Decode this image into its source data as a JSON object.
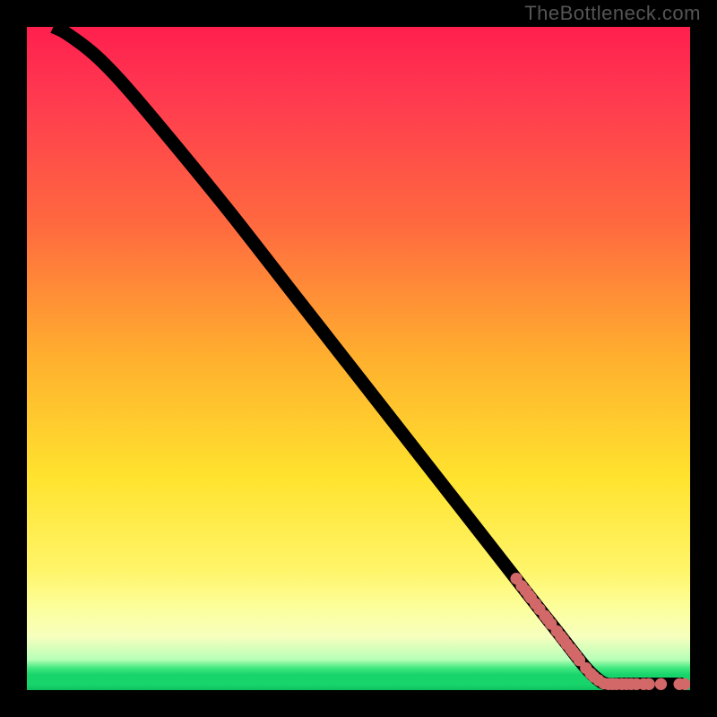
{
  "watermark": "TheBottleneck.com",
  "chart_data": {
    "type": "line",
    "title": "",
    "xlabel": "",
    "ylabel": "",
    "xlim": [
      0,
      100
    ],
    "ylim": [
      0,
      100
    ],
    "curve": [
      {
        "x": 4,
        "y": 100
      },
      {
        "x": 6,
        "y": 99
      },
      {
        "x": 10,
        "y": 96
      },
      {
        "x": 14,
        "y": 92
      },
      {
        "x": 20,
        "y": 85
      },
      {
        "x": 30,
        "y": 72.8
      },
      {
        "x": 40,
        "y": 60
      },
      {
        "x": 50,
        "y": 47.2
      },
      {
        "x": 60,
        "y": 34.4
      },
      {
        "x": 70,
        "y": 21.6
      },
      {
        "x": 77,
        "y": 12.6
      },
      {
        "x": 80,
        "y": 8.8
      },
      {
        "x": 84,
        "y": 3.7
      },
      {
        "x": 86,
        "y": 1.7
      },
      {
        "x": 87.5,
        "y": 0.9
      },
      {
        "x": 90,
        "y": 0.9
      },
      {
        "x": 95,
        "y": 0.9
      },
      {
        "x": 99,
        "y": 0.9
      }
    ],
    "points": [
      {
        "x": 73.8,
        "y": 16.8
      },
      {
        "x": 74.6,
        "y": 15.7
      },
      {
        "x": 75.2,
        "y": 15.0
      },
      {
        "x": 75.7,
        "y": 14.3
      },
      {
        "x": 76.0,
        "y": 13.9
      },
      {
        "x": 76.7,
        "y": 13.0
      },
      {
        "x": 77.3,
        "y": 12.2
      },
      {
        "x": 78.1,
        "y": 11.2
      },
      {
        "x": 78.5,
        "y": 10.7
      },
      {
        "x": 79.0,
        "y": 10.0
      },
      {
        "x": 79.9,
        "y": 8.9
      },
      {
        "x": 80.5,
        "y": 8.1
      },
      {
        "x": 80.9,
        "y": 7.6
      },
      {
        "x": 81.4,
        "y": 6.9
      },
      {
        "x": 82.0,
        "y": 6.2
      },
      {
        "x": 82.4,
        "y": 5.7
      },
      {
        "x": 82.8,
        "y": 5.2
      },
      {
        "x": 83.3,
        "y": 4.5
      },
      {
        "x": 84.3,
        "y": 3.3
      },
      {
        "x": 85.0,
        "y": 2.5
      },
      {
        "x": 85.5,
        "y": 2.0
      },
      {
        "x": 86.2,
        "y": 1.5
      },
      {
        "x": 87.0,
        "y": 1.0
      },
      {
        "x": 87.7,
        "y": 0.9
      },
      {
        "x": 88.3,
        "y": 0.9
      },
      {
        "x": 88.9,
        "y": 0.9
      },
      {
        "x": 89.7,
        "y": 0.9
      },
      {
        "x": 90.4,
        "y": 0.9
      },
      {
        "x": 91.1,
        "y": 0.9
      },
      {
        "x": 91.9,
        "y": 0.9
      },
      {
        "x": 93.0,
        "y": 0.9
      },
      {
        "x": 93.8,
        "y": 0.9
      },
      {
        "x": 95.6,
        "y": 0.9
      },
      {
        "x": 98.4,
        "y": 0.9
      },
      {
        "x": 99.2,
        "y": 0.9
      }
    ],
    "point_color": "#d26868",
    "curve_color": "#000000"
  }
}
